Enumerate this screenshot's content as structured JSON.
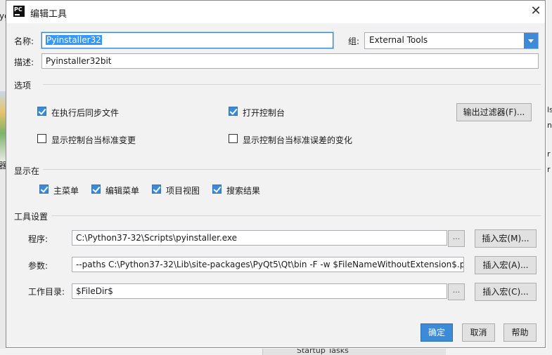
{
  "dialog": {
    "title": "编辑工具",
    "app_icon_text": "PC"
  },
  "name": {
    "label": "名称:",
    "value": "Pyinstaller32"
  },
  "group": {
    "label": "组:",
    "value": "External Tools"
  },
  "description": {
    "label": "描述:",
    "value": "Pyinstaller32bit"
  },
  "options": {
    "title": "选项",
    "sync_files": {
      "label": "在执行后同步文件",
      "checked": true
    },
    "open_console": {
      "label": "打开控制台",
      "checked": true
    },
    "output_filters_button": "输出过滤器(F)...",
    "show_on_stdout": {
      "label": "显示控制台当标准变更",
      "checked": false
    },
    "show_on_stderr": {
      "label": "显示控制台当标准误差的变化",
      "checked": false
    }
  },
  "show_in": {
    "title": "显示在",
    "main_menu": {
      "label": "主菜单",
      "checked": true
    },
    "editor_menu": {
      "label": "编辑菜单",
      "checked": true
    },
    "project_view": {
      "label": "项目视图",
      "checked": true
    },
    "search_results": {
      "label": "搜索结果",
      "checked": true
    }
  },
  "tool_settings": {
    "title": "工具设置",
    "program": {
      "label": "程序:",
      "value": "C:\\Python37-32\\Scripts\\pyinstaller.exe"
    },
    "arguments": {
      "label": "参数:",
      "value": "--paths C:\\Python37-32\\Lib\\site-packages\\PyQt5\\Qt\\bin -F -w $FileNameWithoutExtension$.py"
    },
    "working_dir": {
      "label": "工作目录:",
      "value": "$FileDir$"
    },
    "browse_label": "...",
    "insert_macro_m": "插入宏(M)...",
    "insert_macro_a": "插入宏(A)...",
    "insert_macro_c": "插入宏(C)..."
  },
  "buttons": {
    "ok": "确定",
    "cancel": "取消",
    "help": "帮助"
  },
  "background": {
    "left_text": "yg",
    "left_text2": "器",
    "right_texts": [
      "ls",
      "ne",
      "r",
      "r"
    ],
    "bottom_tab": "Startup Tasks"
  }
}
